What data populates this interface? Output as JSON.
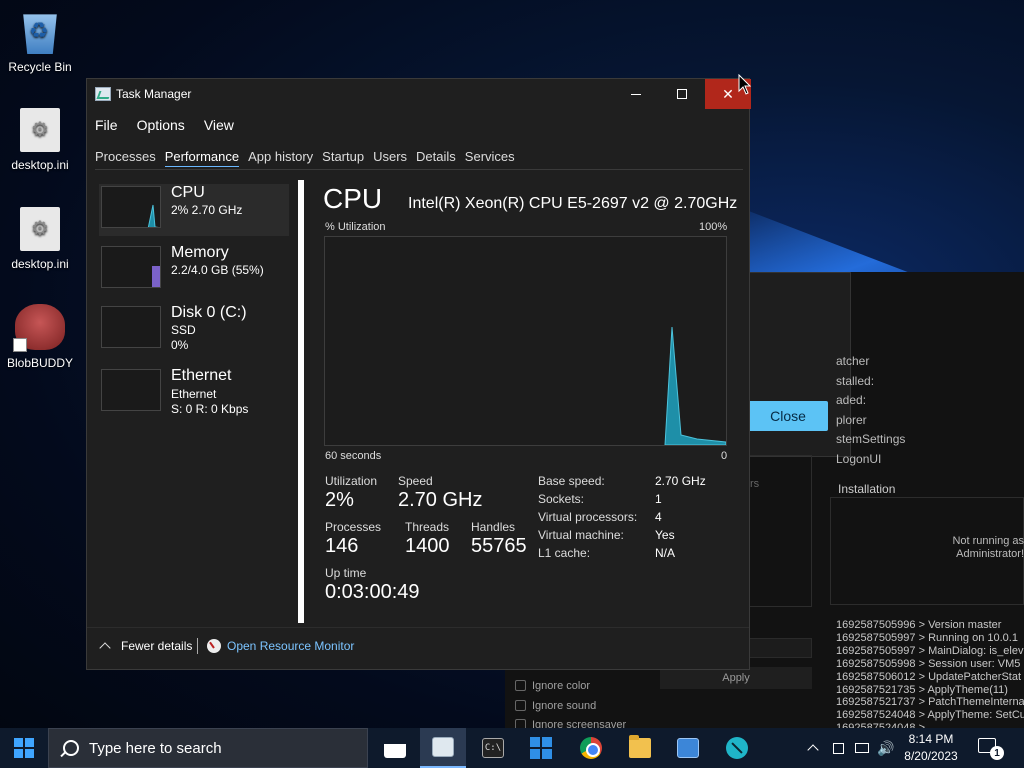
{
  "desktop": {
    "icons": [
      {
        "label": "Recycle Bin"
      },
      {
        "label": "desktop.ini"
      },
      {
        "label": "desktop.ini"
      },
      {
        "label": "BlobBUDDY"
      }
    ]
  },
  "background_app": {
    "close_label": "Close",
    "list_items": [
      "atcher",
      "stalled:",
      "aded:",
      "plorer",
      "stemSettings",
      "LogonUI"
    ],
    "installation_title": "Installation",
    "installation_message": "Not running as Administrator!",
    "rs_text": "rs",
    "apply_label": "Apply",
    "checkboxes": [
      "Ignore color",
      "Ignore sound",
      "Ignore screensaver"
    ],
    "log": [
      "1692587505996 > Version master",
      "1692587505997 > Running on 10.0.1",
      "1692587505997 > MainDialog: is_elev",
      "1692587505998 > Session user: VM5",
      "1692587506012 > UpdatePatcherStat",
      "1692587521735 > ApplyTheme(11)",
      "1692587521737 > PatchThemeInterna",
      "1692587524048 > ApplyTheme: SetCu",
      "1692587524048 >"
    ]
  },
  "task_manager": {
    "title": "Task Manager",
    "menu": [
      "File",
      "Options",
      "View"
    ],
    "tabs": [
      "Processes",
      "Performance",
      "App history",
      "Startup",
      "Users",
      "Details",
      "Services"
    ],
    "active_tab": "Performance",
    "sidebar": [
      {
        "name": "CPU",
        "sub": [
          "2% 2.70 GHz"
        ],
        "selected": true
      },
      {
        "name": "Memory",
        "sub": [
          "2.2/4.0 GB (55%)"
        ],
        "selected": false
      },
      {
        "name": "Disk 0 (C:)",
        "sub": [
          "SSD",
          "0%"
        ],
        "selected": false
      },
      {
        "name": "Ethernet",
        "sub": [
          "Ethernet",
          "S: 0 R: 0 Kbps"
        ],
        "selected": false
      }
    ],
    "cpu": {
      "title": "CPU",
      "model": "Intel(R) Xeon(R) CPU E5-2697 v2 @ 2.70GHz",
      "util_label": "% Utilization",
      "util_max": "100%",
      "graph_left": "60 seconds",
      "graph_right": "0",
      "utilization_label": "Utilization",
      "utilization": "2%",
      "speed_label": "Speed",
      "speed": "2.70 GHz",
      "processes_label": "Processes",
      "processes": "146",
      "threads_label": "Threads",
      "threads": "1400",
      "handles_label": "Handles",
      "handles": "55765",
      "uptime_label": "Up time",
      "uptime": "0:03:00:49",
      "details": [
        {
          "key": "Base speed:",
          "value": "2.70 GHz"
        },
        {
          "key": "Sockets:",
          "value": "1"
        },
        {
          "key": "Virtual processors:",
          "value": "4"
        },
        {
          "key": "Virtual machine:",
          "value": "Yes"
        },
        {
          "key": "L1 cache:",
          "value": "N/A"
        }
      ],
      "graph_color": "#1e8fa8"
    },
    "footer": {
      "fewer_details": "Fewer details",
      "resource_monitor": "Open Resource Monitor"
    }
  },
  "taskbar": {
    "search_placeholder": "Type here to search",
    "cmd_glyph": "C:\\",
    "time": "8:14 PM",
    "date": "8/20/2023",
    "notification_count": "1",
    "volume_glyph": "🔊"
  }
}
